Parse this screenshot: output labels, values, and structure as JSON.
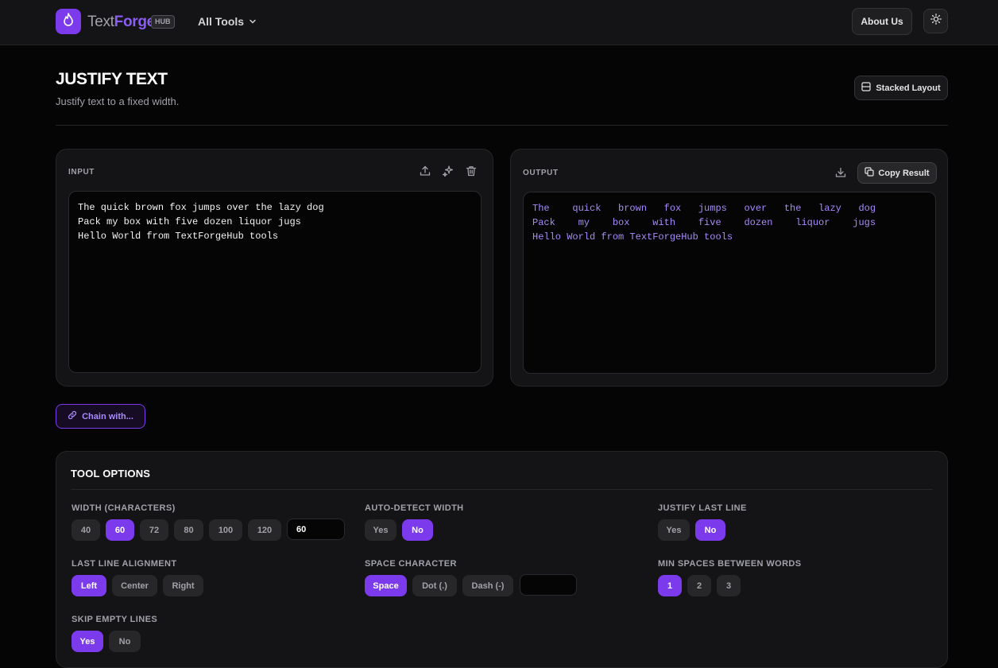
{
  "header": {
    "brand_text": "Text",
    "brand_bold": "Forge",
    "badge": "HUB",
    "all_tools": "All Tools",
    "about": "About Us",
    "logo_icon": "flame-icon",
    "theme_icon": "sun-icon"
  },
  "page": {
    "title": "JUSTIFY TEXT",
    "subtitle": "Justify text to a fixed width.",
    "layout_button": "Stacked Layout"
  },
  "input": {
    "label": "INPUT",
    "text": "The quick brown fox jumps over the lazy dog\nPack my box with five dozen liquor jugs\nHello World from TextForgeHub tools"
  },
  "output": {
    "label": "OUTPUT",
    "copy": "Copy Result",
    "text": "The    quick   brown   fox   jumps   over   the   lazy   dog\nPack    my    box    with    five    dozen    liquor    jugs\nHello World from TextForgeHub tools"
  },
  "chain": {
    "label": "Chain with..."
  },
  "options": {
    "title": "TOOL OPTIONS",
    "width": {
      "label": "WIDTH (CHARACTERS)",
      "choices": [
        "40",
        "60",
        "72",
        "80",
        "100",
        "120"
      ],
      "selected": "60",
      "custom_value": "60"
    },
    "auto_detect": {
      "label": "AUTO-DETECT WIDTH",
      "choices": [
        "Yes",
        "No"
      ],
      "selected": "No"
    },
    "justify_last": {
      "label": "JUSTIFY LAST LINE",
      "choices": [
        "Yes",
        "No"
      ],
      "selected": "No"
    },
    "last_align": {
      "label": "LAST LINE ALIGNMENT",
      "choices": [
        "Left",
        "Center",
        "Right"
      ],
      "selected": "Left"
    },
    "space_char": {
      "label": "SPACE CHARACTER",
      "choices": [
        "Space",
        "Dot (.)",
        "Dash (-)"
      ],
      "selected": "Space",
      "custom_value": ""
    },
    "min_spaces": {
      "label": "MIN SPACES BETWEEN WORDS",
      "choices": [
        "1",
        "2",
        "3"
      ],
      "selected": "1"
    },
    "skip_empty": {
      "label": "SKIP EMPTY LINES",
      "choices": [
        "Yes",
        "No"
      ],
      "selected": "Yes"
    }
  },
  "colors": {
    "accent": "#7c3aed",
    "accent_text": "#a78bfa",
    "background": "#050506",
    "panel": "#141416"
  }
}
